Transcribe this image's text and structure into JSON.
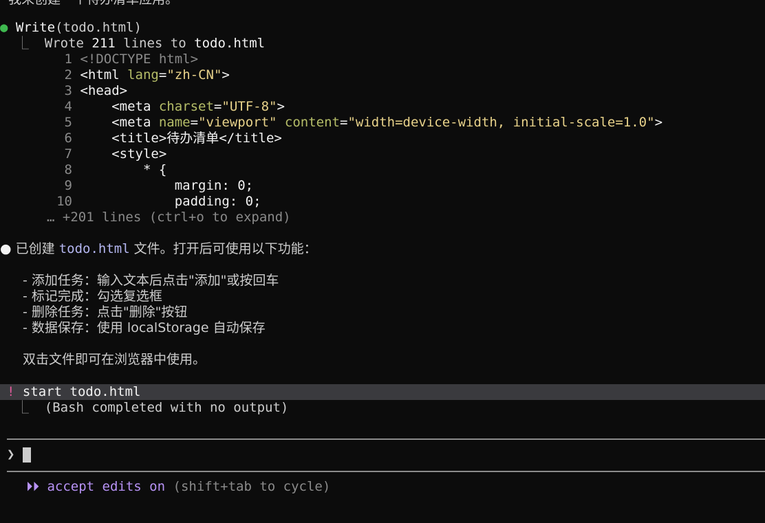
{
  "top_partial": "· 我来创建一个待办清单应用。",
  "write_tool": {
    "name": "Write",
    "arg": "(todo.html)",
    "result_prefix": "Wrote ",
    "result_count": "211",
    "result_mid": " lines to ",
    "result_file": "todo.html",
    "collapsed": "… +201 lines (ctrl+o to expand)"
  },
  "code_lines": [
    {
      "n": "1"
    },
    {
      "n": "2"
    },
    {
      "n": "3"
    },
    {
      "n": "4"
    },
    {
      "n": "5"
    },
    {
      "n": "6"
    },
    {
      "n": "7"
    },
    {
      "n": "8"
    },
    {
      "n": "9"
    },
    {
      "n": "10"
    }
  ],
  "code": {
    "l1": "<!DOCTYPE html>",
    "l2_tag": "<html ",
    "l2_attr": "lang",
    "l2_eq": "=",
    "l2_val": "\"zh-CN\"",
    "l2_end": ">",
    "l3": "<head>",
    "l4_tag": "    <meta ",
    "l4_attr": "charset",
    "l4_eq": "=",
    "l4_val": "\"UTF-8\"",
    "l4_end": ">",
    "l5_tag": "    <meta ",
    "l5_attr1": "name",
    "l5_eq1": "=",
    "l5_val1": "\"viewport\"",
    "l5_sp": " ",
    "l5_attr2": "content",
    "l5_eq2": "=",
    "l5_val2": "\"width=device-width, initial-scale=1.0\"",
    "l5_end": ">",
    "l6_open": "    <title>",
    "l6_text": "待办清单",
    "l6_close": "</title>",
    "l7": "    <style>",
    "l8": "        * {",
    "l9": "            margin: 0;",
    "l10": "            padding: 0;"
  },
  "assistant": {
    "prefix": "已创建 ",
    "file": "todo.html",
    "suffix": " 文件。打开后可使用以下功能：",
    "bullets": [
      "- 添加任务：输入文本后点击\"添加\"或按回车",
      "- 标记完成：勾选复选框",
      "- 删除任务：点击\"删除\"按钮",
      "- 数据保存：使用 localStorage 自动保存"
    ],
    "closing": "双击文件即可在浏览器中使用。"
  },
  "bash": {
    "bang": "!",
    "command": "start todo.html",
    "result": "(Bash completed with no output)"
  },
  "prompt": {
    "chevron": "❯",
    "value": ""
  },
  "status": {
    "icon": "⏵⏵",
    "mode": "accept edits on",
    "hint": " (shift+tab to cycle)"
  },
  "colors": {
    "background": "#0c0c0c",
    "tool_dot": "#3fb950",
    "accent_purple": "#b792f5",
    "bang_pink": "#e05a9a",
    "attr_green": "#b5bd68",
    "string_yellow": "#e8d28a",
    "file_blue": "#b4b6f0"
  }
}
